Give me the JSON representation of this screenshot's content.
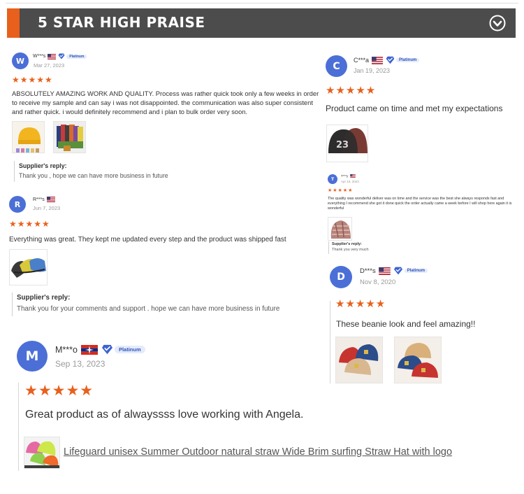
{
  "section": {
    "title": "5 STAR HIGH PRAISE",
    "expand_icon": "chevron-down-circle-icon",
    "accent_color": "#e8601c",
    "bar_color": "#4c4c4c"
  },
  "colors": {
    "star": "#e8601c",
    "avatar": "#4b6fd6",
    "badge": "#2f55b8"
  },
  "reviews": [
    {
      "initial": "W",
      "name": "W***s",
      "badge": "Platinum",
      "date": "Mar 27, 2023",
      "rating": 5,
      "stars": "★★★★★",
      "text": "ABSOLUTELY AMAZING WORK AND QUALITY. Process was rather quick took only a few weeks in order to receive my sample and can say i was not disappointed. the communication was also super consistent and rather quick. i would definitely recommend and i plan to bulk order very soon.",
      "reply_label": "Supplier's reply:",
      "reply": "Thank you , hope we can have more business in future"
    },
    {
      "initial": "R",
      "name": "R***s",
      "date": "Jun 7, 2023",
      "rating": 5,
      "stars": "★★★★★",
      "text": "Everything was great. They kept me updated every step and the product was shipped fast",
      "reply_label": "Supplier's reply:",
      "reply": "Thank you for your comments and support . hope we can have more business in future"
    },
    {
      "initial": "M",
      "name": "M***o",
      "badge": "Platinum",
      "date": "Sep 13, 2023",
      "rating": 5,
      "stars": "★★★★★",
      "text": "Great product as of alwayssss love working with Angela.",
      "product_link": "Lifeguard unisex Summer Outdoor natural straw Wide Brim surfing Straw Hat with logo"
    },
    {
      "initial": "C",
      "name": "C***a",
      "badge": "Platinum",
      "date": "Jan 19, 2023",
      "rating": 5,
      "stars": "★★★★★",
      "text": "Product came on time and met my expectations"
    },
    {
      "initial": "T",
      "name": "T***y",
      "date": "Apr 15, 2023",
      "rating": 5,
      "stars": "★★★★★",
      "text": "The quality was wonderful deliver was on time and the service was the best she always responds fast and everything I recommend she got it done quick the order actually came a week before I will shop here again it is wonderful",
      "reply_label": "Supplier's reply:",
      "reply": "Thank you very much"
    },
    {
      "initial": "D",
      "name": "D***s",
      "badge": "Platinum",
      "date": "Nov 8, 2020",
      "rating": 5,
      "stars": "★★★★★",
      "text": "These beanie look and feel amazing!!"
    }
  ]
}
